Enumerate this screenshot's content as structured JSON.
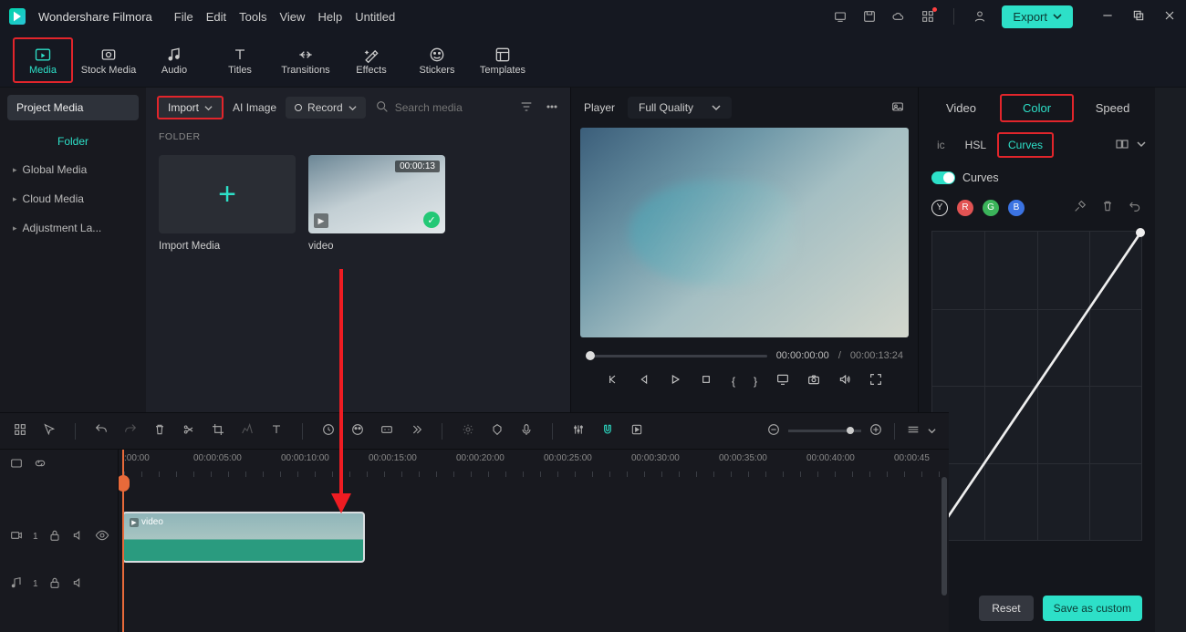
{
  "app_name": "Wondershare Filmora",
  "document_title": "Untitled",
  "menubar": {
    "file": "File",
    "edit": "Edit",
    "tools": "Tools",
    "view": "View",
    "help": "Help"
  },
  "export_label": "Export",
  "mode_tabs": {
    "media": "Media",
    "stock": "Stock Media",
    "audio": "Audio",
    "titles": "Titles",
    "transitions": "Transitions",
    "effects": "Effects",
    "stickers": "Stickers",
    "templates": "Templates"
  },
  "sidebar": {
    "project_media": "Project Media",
    "folder": "Folder",
    "items": [
      "Global Media",
      "Cloud Media",
      "Adjustment La..."
    ]
  },
  "media_toolbar": {
    "import": "Import",
    "ai_image": "AI Image",
    "record": "Record",
    "search_placeholder": "Search media"
  },
  "folder_header": "FOLDER",
  "thumbs": {
    "import_media": "Import Media",
    "video_name": "video",
    "video_duration": "00:00:13"
  },
  "player": {
    "label": "Player",
    "quality": "Full Quality",
    "current_time": "00:00:00:00",
    "total_time": "00:00:13:24",
    "time_sep": "/"
  },
  "right_tabs": {
    "video": "Video",
    "color": "Color",
    "speed": "Speed"
  },
  "right_subtabs": {
    "ic": "ic",
    "hsl": "HSL",
    "curves": "Curves"
  },
  "curves_label": "Curves",
  "channels": {
    "y": "Y",
    "r": "R",
    "g": "G",
    "b": "B"
  },
  "buttons": {
    "reset": "Reset",
    "save_custom": "Save as custom"
  },
  "timeline": {
    "ticks": [
      ":00:00",
      "00:00:05:00",
      "00:00:10:00",
      "00:00:15:00",
      "00:00:20:00",
      "00:00:25:00",
      "00:00:30:00",
      "00:00:35:00",
      "00:00:40:00",
      "00:00:45"
    ],
    "clip_label": "video",
    "track_video_index": "1",
    "track_audio_index": "1"
  }
}
